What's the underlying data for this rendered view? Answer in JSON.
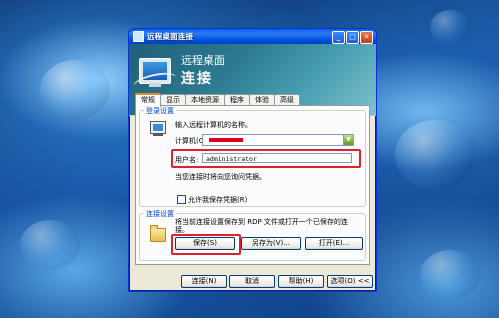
{
  "window": {
    "title": "远程桌面连接"
  },
  "banner": {
    "line1": "远程桌面",
    "line2": "连接"
  },
  "tabs": [
    "常规",
    "显示",
    "本地资源",
    "程序",
    "体验",
    "高级"
  ],
  "logon": {
    "legend": "登录设置",
    "prompt": "输入远程计算机的名称。",
    "computer_label": "计算机(C):",
    "username_label": "用户名:",
    "username_value": "administrator",
    "credentials_note": "当您连接时将向您询问凭据。",
    "save_credentials_label": "允许我保存凭据(R)",
    "save_credentials_checked": false
  },
  "connection": {
    "legend": "连接设置",
    "description": "将当前连接设置保存到 RDP 文件或打开一个已保存的连接。",
    "save_button": "保存(S)",
    "save_as_button": "另存为(V)...",
    "open_button": "打开(E)..."
  },
  "footer": {
    "connect_button": "连接(N)",
    "cancel_button": "取消",
    "help_button": "帮助(H)",
    "options_button": "选项(O) <<"
  },
  "colors": {
    "highlight": "#e0202a",
    "titlebar": "#0054e3",
    "banner": "#2d7b92"
  }
}
